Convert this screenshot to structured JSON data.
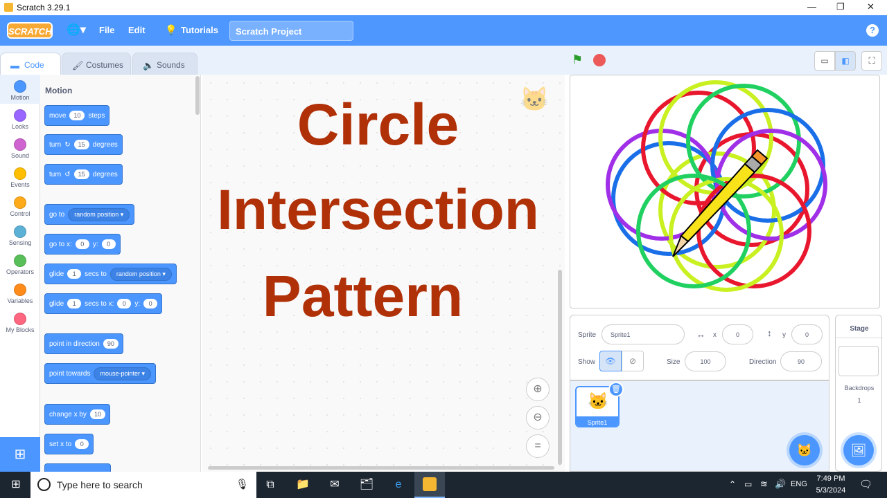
{
  "window": {
    "title": "Scratch 3.29.1"
  },
  "menu": {
    "file": "File",
    "edit": "Edit",
    "tutorials": "Tutorials",
    "project_title": "Scratch Project",
    "logo": "SCRATCH"
  },
  "tabs": {
    "code": "Code",
    "costumes": "Costumes",
    "sounds": "Sounds"
  },
  "categories": [
    {
      "label": "Motion",
      "color": "#4c97ff"
    },
    {
      "label": "Looks",
      "color": "#9966ff"
    },
    {
      "label": "Sound",
      "color": "#cf63cf"
    },
    {
      "label": "Events",
      "color": "#ffbf00"
    },
    {
      "label": "Control",
      "color": "#ffab19"
    },
    {
      "label": "Sensing",
      "color": "#5cb1d6"
    },
    {
      "label": "Operators",
      "color": "#59c059"
    },
    {
      "label": "Variables",
      "color": "#ff8c1a"
    },
    {
      "label": "My Blocks",
      "color": "#ff6680"
    }
  ],
  "palette": {
    "heading": "Motion",
    "move": {
      "a": "move",
      "v": "10",
      "b": "steps"
    },
    "turn_right": {
      "a": "turn",
      "v": "15",
      "b": "degrees"
    },
    "turn_left": {
      "a": "turn",
      "v": "15",
      "b": "degrees"
    },
    "goto": {
      "a": "go to",
      "d": "random position"
    },
    "goto_xy": {
      "a": "go to x:",
      "x": "0",
      "b": "y:",
      "y": "0"
    },
    "glide": {
      "a": "glide",
      "v": "1",
      "b": "secs to",
      "d": "random position"
    },
    "glide_xy": {
      "a": "glide",
      "v": "1",
      "b": "secs to x:",
      "x": "0",
      "c": "y:",
      "y": "0"
    },
    "point_dir": {
      "a": "point in direction",
      "v": "90"
    },
    "point_towards": {
      "a": "point towards",
      "d": "mouse-pointer"
    },
    "change_x": {
      "a": "change x by",
      "v": "10"
    },
    "set_x": {
      "a": "set x to",
      "v": "0"
    }
  },
  "overlay": {
    "line1": "Circle",
    "line2": "Intersection",
    "line3": "Pattern"
  },
  "sprite_info": {
    "sprite_label": "Sprite",
    "sprite_name": "Sprite1",
    "x_label": "x",
    "x": "0",
    "y_label": "y",
    "y": "0",
    "show_label": "Show",
    "size_label": "Size",
    "size": "100",
    "direction_label": "Direction",
    "direction": "90"
  },
  "sprite_list": {
    "sprite1": "Sprite1"
  },
  "stage_panel": {
    "title": "Stage",
    "backdrops_label": "Backdrops",
    "backdrops_count": "1"
  },
  "taskbar": {
    "search_placeholder": "Type here to search",
    "lang": "ENG",
    "time": "7:49 PM",
    "date": "5/3/2024"
  }
}
